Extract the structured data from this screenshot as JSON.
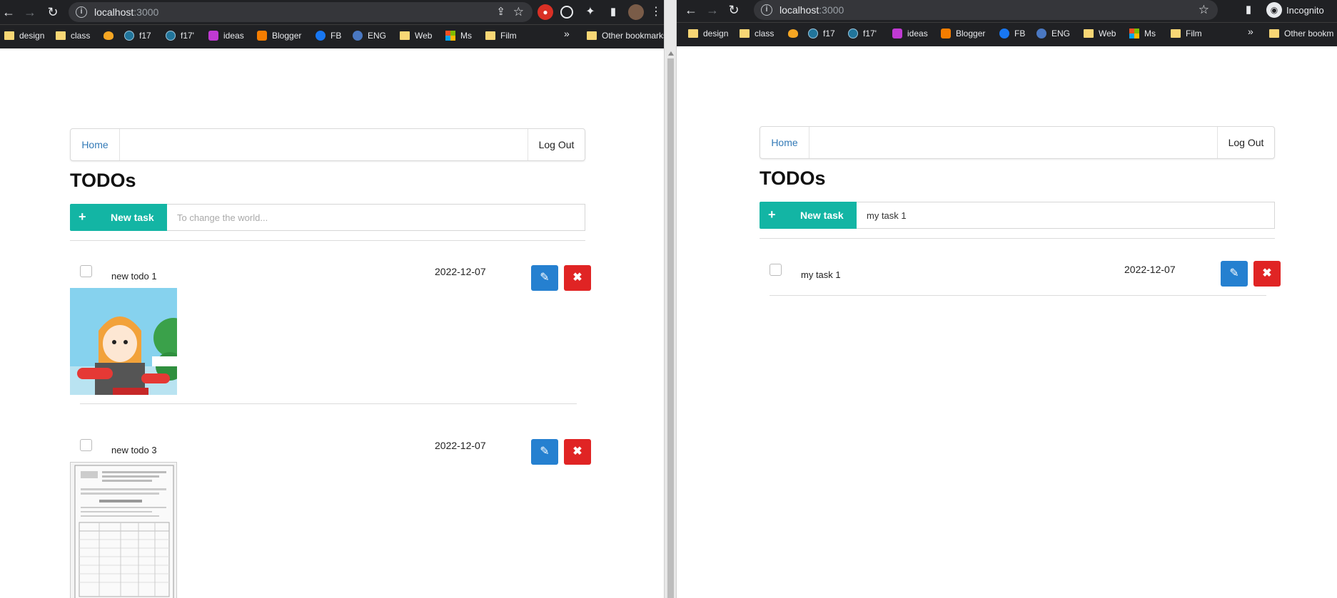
{
  "browser_left": {
    "url_host": "localhost",
    "url_port": ":3000"
  },
  "browser_right": {
    "url_host": "localhost",
    "url_port": ":3000",
    "incognito_label": "Incognito"
  },
  "bookmarks": [
    "design",
    "class",
    "f17",
    "f17'",
    "ideas",
    "Blogger",
    "FB",
    "ENG",
    "Web",
    "Ms",
    "Film"
  ],
  "bookmark_icons": [
    "folder",
    "folder",
    "fire",
    "wp",
    "wp",
    "ideas",
    "blogger",
    "fb",
    "eng",
    "folder",
    "ms",
    "folder"
  ],
  "other_bookmarks_left": "Other bookmarks",
  "other_bookmarks_right": "Other bookm",
  "chevron": "»",
  "app_left": {
    "nav": {
      "home": "Home",
      "logout": "Log Out"
    },
    "title": "TODOs",
    "new_task_label": "New task",
    "new_task_placeholder": "To change the world...",
    "new_task_value": "",
    "todos": [
      {
        "text": "new todo 1",
        "date": "2022-12-07"
      },
      {
        "text": "new todo 3",
        "date": "2022-12-07"
      }
    ]
  },
  "app_right": {
    "nav": {
      "home": "Home",
      "logout": "Log Out"
    },
    "title": "TODOs",
    "new_task_label": "New task",
    "new_task_placeholder": "To change the world...",
    "new_task_value": "my task 1",
    "todos": [
      {
        "text": "my task 1",
        "date": "2022-12-07"
      }
    ]
  },
  "icons": {
    "plus": "+",
    "edit": "✎",
    "delete": "✖"
  },
  "colors": {
    "new_task_teal": "#13b5a4",
    "edit_blue": "#2580d0",
    "delete_red": "#e02424",
    "link_blue": "#337ab7"
  }
}
